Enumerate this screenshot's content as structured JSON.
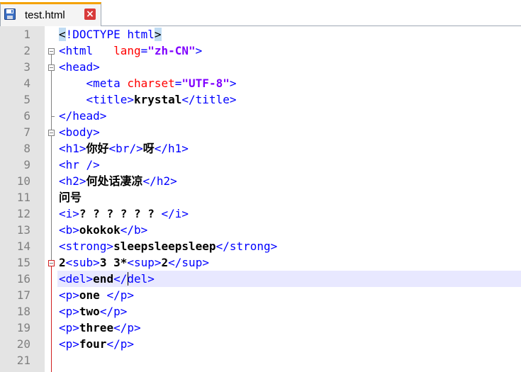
{
  "tab": {
    "filename": "test.html",
    "save_icon": "floppy-save-icon",
    "close_icon": "close-tab-icon"
  },
  "editor": {
    "line_numbers": [
      "1",
      "2",
      "3",
      "4",
      "5",
      "6",
      "7",
      "8",
      "9",
      "10",
      "11",
      "12",
      "13",
      "14",
      "15",
      "16",
      "17",
      "18",
      "19",
      "20",
      "21"
    ],
    "current_line": 16,
    "lines": [
      [
        {
          "c": "doc",
          "t": "<"
        },
        {
          "c": "t",
          "t": "!DOCTYPE html"
        },
        {
          "c": "doc",
          "t": ">"
        }
      ],
      [
        {
          "c": "t",
          "t": "<html   "
        },
        {
          "c": "a",
          "t": "lang"
        },
        {
          "c": "t",
          "t": "="
        },
        {
          "c": "v",
          "t": "\"zh-CN\""
        },
        {
          "c": "t",
          "t": ">"
        }
      ],
      [
        {
          "c": "t",
          "t": "<head>"
        }
      ],
      [
        {
          "c": "",
          "t": "    "
        },
        {
          "c": "t",
          "t": "<meta "
        },
        {
          "c": "a",
          "t": "charset"
        },
        {
          "c": "t",
          "t": "="
        },
        {
          "c": "v",
          "t": "\"UTF-8\""
        },
        {
          "c": "t",
          "t": ">"
        }
      ],
      [
        {
          "c": "",
          "t": "    "
        },
        {
          "c": "t",
          "t": "<title>"
        },
        {
          "c": "x",
          "t": "krystal"
        },
        {
          "c": "t",
          "t": "</title>"
        }
      ],
      [
        {
          "c": "t",
          "t": "</head>"
        }
      ],
      [
        {
          "c": "t",
          "t": "<body>"
        }
      ],
      [
        {
          "c": "t",
          "t": "<h1>"
        },
        {
          "c": "cj",
          "t": "你好"
        },
        {
          "c": "t",
          "t": "<br/>"
        },
        {
          "c": "cj",
          "t": "呀"
        },
        {
          "c": "t",
          "t": "</h1>"
        }
      ],
      [
        {
          "c": "t",
          "t": "<hr />"
        }
      ],
      [
        {
          "c": "t",
          "t": "<h2>"
        },
        {
          "c": "cj",
          "t": "何处话凄凉"
        },
        {
          "c": "t",
          "t": "</h2>"
        }
      ],
      [
        {
          "c": "cj",
          "t": "问号"
        }
      ],
      [
        {
          "c": "t",
          "t": "<i>"
        },
        {
          "c": "x",
          "t": "? ? ? ? ? ? "
        },
        {
          "c": "t",
          "t": "</i>"
        }
      ],
      [
        {
          "c": "t",
          "t": "<b>"
        },
        {
          "c": "x",
          "t": "okokok"
        },
        {
          "c": "t",
          "t": "</b>"
        }
      ],
      [
        {
          "c": "t",
          "t": "<strong>"
        },
        {
          "c": "x",
          "t": "sleepsleepsleep"
        },
        {
          "c": "t",
          "t": "</strong>"
        }
      ],
      [
        {
          "c": "x",
          "t": "2"
        },
        {
          "c": "t",
          "t": "<sub>"
        },
        {
          "c": "x",
          "t": "3 3*"
        },
        {
          "c": "t",
          "t": "<sup>"
        },
        {
          "c": "x",
          "t": "2"
        },
        {
          "c": "t",
          "t": "</sup>"
        }
      ],
      [
        {
          "c": "t",
          "t": "<del>"
        },
        {
          "c": "x",
          "t": "end"
        },
        {
          "c": "t",
          "t": "</del>"
        }
      ],
      [
        {
          "c": "t",
          "t": "<p>"
        },
        {
          "c": "x",
          "t": "one "
        },
        {
          "c": "t",
          "t": "</p>"
        }
      ],
      [
        {
          "c": "t",
          "t": "<p>"
        },
        {
          "c": "x",
          "t": "two"
        },
        {
          "c": "t",
          "t": "</p>"
        }
      ],
      [
        {
          "c": "t",
          "t": "<p>"
        },
        {
          "c": "x",
          "t": "three"
        },
        {
          "c": "t",
          "t": "</p>"
        }
      ],
      [
        {
          "c": "t",
          "t": "<p>"
        },
        {
          "c": "x",
          "t": "four"
        },
        {
          "c": "t",
          "t": "</p>"
        }
      ],
      []
    ]
  },
  "colors": {
    "tag": "#0000ff",
    "attribute": "#ff0000",
    "value": "#8000ff",
    "text": "#000000",
    "gutter": "#e4e4e4",
    "current_line": "#e8e8ff",
    "tab_accent": "#f4a200"
  }
}
